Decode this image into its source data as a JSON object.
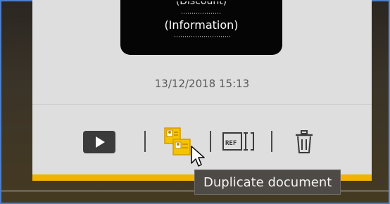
{
  "card": {
    "discount_label": "(Discount)",
    "information_label": "(Information)",
    "timestamp": "13/12/2018 15:13"
  },
  "actions": {
    "items": [
      {
        "icon": "play-icon"
      },
      {
        "icon": "duplicate-document-icon",
        "highlighted": true
      },
      {
        "icon": "ref-icon",
        "text": "REF"
      },
      {
        "icon": "trash-icon"
      }
    ]
  },
  "tooltip": {
    "text": "Duplicate document"
  },
  "colors": {
    "accent": "#f0b400",
    "panel": "#050505",
    "card_bg": "#dedede",
    "tooltip_bg": "#4e4a45"
  }
}
